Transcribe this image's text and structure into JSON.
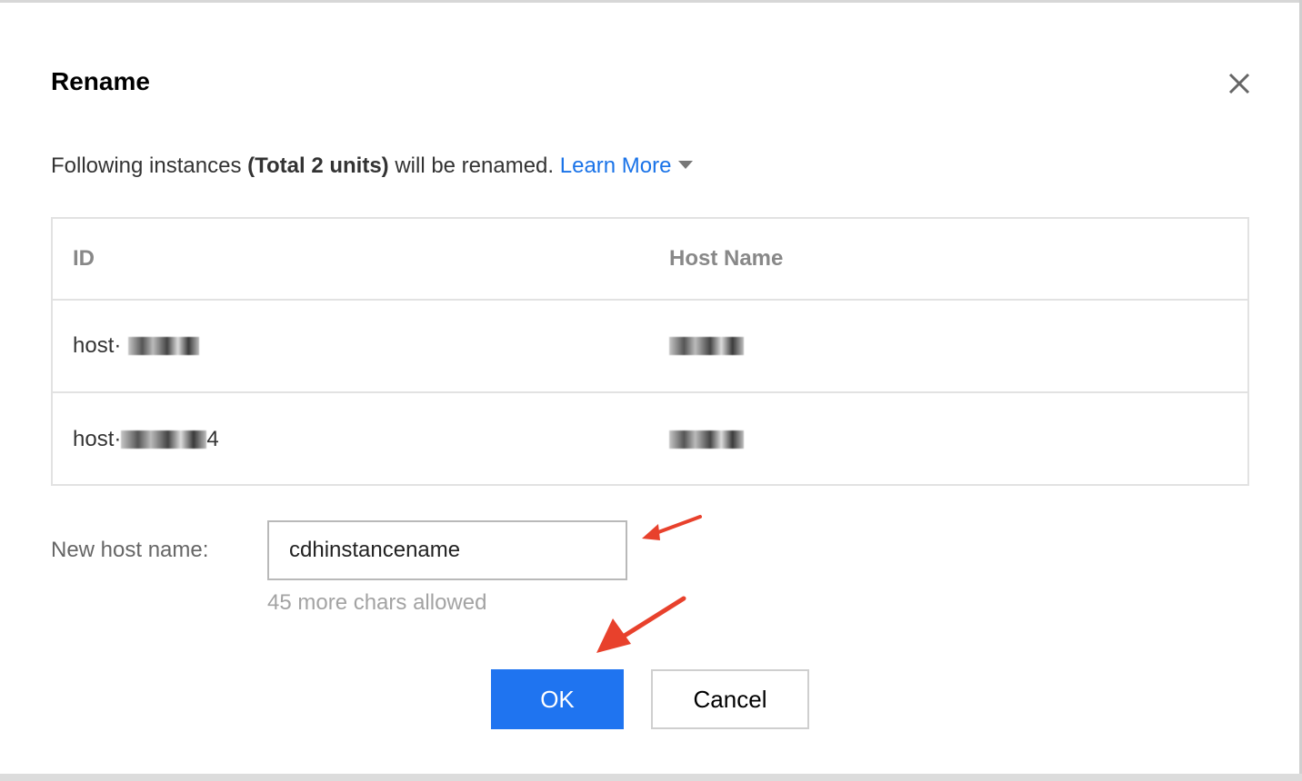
{
  "dialog": {
    "title": "Rename",
    "close_icon": "close-icon"
  },
  "description": {
    "prefix": "Following instances ",
    "total": "(Total 2 units)",
    "suffix": " will be renamed. ",
    "learn_more": "Learn More",
    "caret_icon": "caret-down-icon"
  },
  "table": {
    "columns": [
      "ID",
      "Host Name"
    ],
    "rows": [
      {
        "id_prefix": "host·",
        "id_tail": "",
        "host_name": ""
      },
      {
        "id_prefix": "host·",
        "id_tail": "4",
        "host_name": ""
      }
    ]
  },
  "form": {
    "label": "New host name:",
    "value": "cdhinstancename",
    "hint": "45 more chars allowed"
  },
  "buttons": {
    "ok": "OK",
    "cancel": "Cancel"
  },
  "colors": {
    "primary": "#1f74f0",
    "link": "#1a73e8",
    "annotation_arrow": "#e8412c"
  }
}
